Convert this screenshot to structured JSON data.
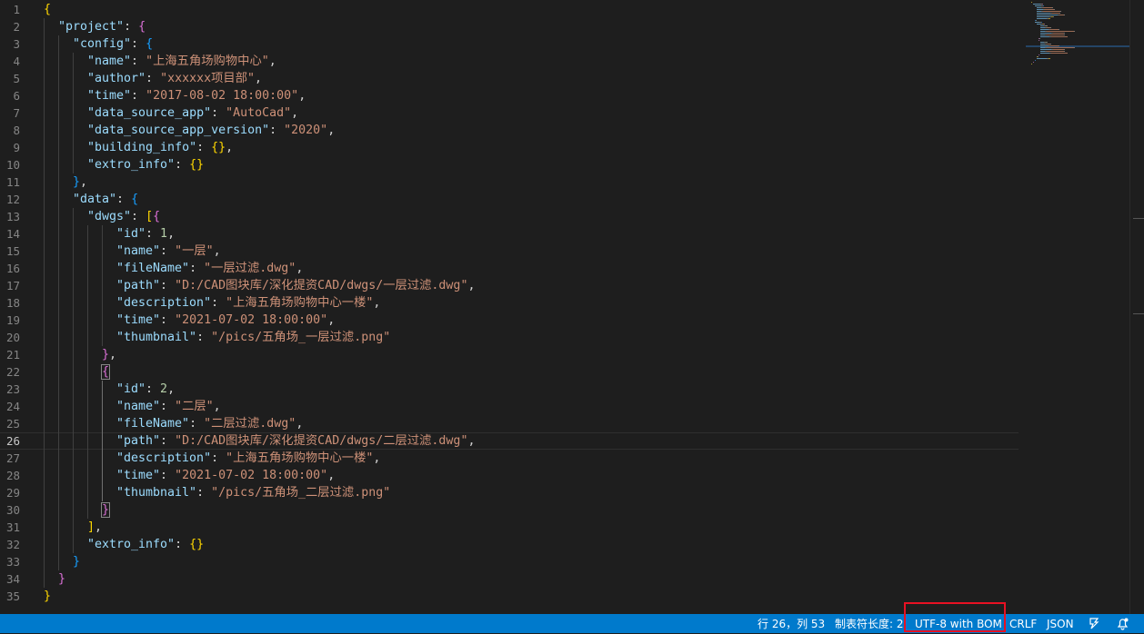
{
  "editor": {
    "current_line": 26,
    "lines": [
      [
        [
          "b1",
          "{"
        ]
      ],
      [
        [
          "k",
          "\"project\""
        ],
        [
          "p",
          ": "
        ],
        [
          "b2",
          "{"
        ]
      ],
      [
        [
          "k",
          "\"config\""
        ],
        [
          "p",
          ": "
        ],
        [
          "b3",
          "{"
        ]
      ],
      [
        [
          "k",
          "\"name\""
        ],
        [
          "p",
          ": "
        ],
        [
          "s",
          "\"上海五角场购物中心\""
        ],
        [
          "p",
          ","
        ]
      ],
      [
        [
          "k",
          "\"author\""
        ],
        [
          "p",
          ": "
        ],
        [
          "s",
          "\"xxxxxx项目部\""
        ],
        [
          "p",
          ","
        ]
      ],
      [
        [
          "k",
          "\"time\""
        ],
        [
          "p",
          ": "
        ],
        [
          "s",
          "\"2017-08-02 18:00:00\""
        ],
        [
          "p",
          ","
        ]
      ],
      [
        [
          "k",
          "\"data_source_app\""
        ],
        [
          "p",
          ": "
        ],
        [
          "s",
          "\"AutoCad\""
        ],
        [
          "p",
          ","
        ]
      ],
      [
        [
          "k",
          "\"data_source_app_version\""
        ],
        [
          "p",
          ": "
        ],
        [
          "s",
          "\"2020\""
        ],
        [
          "p",
          ","
        ]
      ],
      [
        [
          "k",
          "\"building_info\""
        ],
        [
          "p",
          ": "
        ],
        [
          "b1",
          "{}"
        ],
        [
          "p",
          ","
        ]
      ],
      [
        [
          "k",
          "\"extro_info\""
        ],
        [
          "p",
          ": "
        ],
        [
          "b1",
          "{}"
        ]
      ],
      [
        [
          "b3",
          "}"
        ],
        [
          "p",
          ","
        ]
      ],
      [
        [
          "k",
          "\"data\""
        ],
        [
          "p",
          ": "
        ],
        [
          "b3",
          "{"
        ]
      ],
      [
        [
          "k",
          "\"dwgs\""
        ],
        [
          "p",
          ": "
        ],
        [
          "b1",
          "["
        ],
        [
          "b2",
          "{"
        ]
      ],
      [
        [
          "k",
          "\"id\""
        ],
        [
          "p",
          ": "
        ],
        [
          "n",
          "1"
        ],
        [
          "p",
          ","
        ]
      ],
      [
        [
          "k",
          "\"name\""
        ],
        [
          "p",
          ": "
        ],
        [
          "s",
          "\"一层\""
        ],
        [
          "p",
          ","
        ]
      ],
      [
        [
          "k",
          "\"fileName\""
        ],
        [
          "p",
          ": "
        ],
        [
          "s",
          "\"一层过滤.dwg\""
        ],
        [
          "p",
          ","
        ]
      ],
      [
        [
          "k",
          "\"path\""
        ],
        [
          "p",
          ": "
        ],
        [
          "s",
          "\"D:/CAD图块库/深化提资CAD/dwgs/一层过滤.dwg\""
        ],
        [
          "p",
          ","
        ]
      ],
      [
        [
          "k",
          "\"description\""
        ],
        [
          "p",
          ": "
        ],
        [
          "s",
          "\"上海五角场购物中心一楼\""
        ],
        [
          "p",
          ","
        ]
      ],
      [
        [
          "k",
          "\"time\""
        ],
        [
          "p",
          ": "
        ],
        [
          "s",
          "\"2021-07-02 18:00:00\""
        ],
        [
          "p",
          ","
        ]
      ],
      [
        [
          "k",
          "\"thumbnail\""
        ],
        [
          "p",
          ": "
        ],
        [
          "s",
          "\"/pics/五角场_一层过滤.png\""
        ]
      ],
      [
        [
          "b2",
          "}"
        ],
        [
          "p",
          ","
        ]
      ],
      [
        [
          "b2m",
          "{"
        ]
      ],
      [
        [
          "k",
          "\"id\""
        ],
        [
          "p",
          ": "
        ],
        [
          "n",
          "2"
        ],
        [
          "p",
          ","
        ]
      ],
      [
        [
          "k",
          "\"name\""
        ],
        [
          "p",
          ": "
        ],
        [
          "s",
          "\"二层\""
        ],
        [
          "p",
          ","
        ]
      ],
      [
        [
          "k",
          "\"fileName\""
        ],
        [
          "p",
          ": "
        ],
        [
          "s",
          "\"二层过滤.dwg\""
        ],
        [
          "p",
          ","
        ]
      ],
      [
        [
          "k",
          "\"path\""
        ],
        [
          "p",
          ": "
        ],
        [
          "s",
          "\"D:/CAD图块库/深化提资CAD/dwgs/二层过滤.dwg\""
        ],
        [
          "p",
          ","
        ]
      ],
      [
        [
          "k",
          "\"description\""
        ],
        [
          "p",
          ": "
        ],
        [
          "s",
          "\"上海五角场购物中心一楼\""
        ],
        [
          "p",
          ","
        ]
      ],
      [
        [
          "k",
          "\"time\""
        ],
        [
          "p",
          ": "
        ],
        [
          "s",
          "\"2021-07-02 18:00:00\""
        ],
        [
          "p",
          ","
        ]
      ],
      [
        [
          "k",
          "\"thumbnail\""
        ],
        [
          "p",
          ": "
        ],
        [
          "s",
          "\"/pics/五角场_二层过滤.png\""
        ]
      ],
      [
        [
          "b2m",
          "}"
        ]
      ],
      [
        [
          "b1",
          "]"
        ],
        [
          "p",
          ","
        ]
      ],
      [
        [
          "k",
          "\"extro_info\""
        ],
        [
          "p",
          ": "
        ],
        [
          "b1",
          "{}"
        ]
      ],
      [
        [
          "b3",
          "}"
        ]
      ],
      [
        [
          "b2",
          "}"
        ]
      ],
      [
        [
          "b1",
          "}"
        ]
      ]
    ],
    "indents": [
      0,
      1,
      2,
      3,
      3,
      3,
      3,
      3,
      3,
      3,
      2,
      2,
      3,
      5,
      5,
      5,
      5,
      5,
      5,
      5,
      4,
      4,
      5,
      5,
      5,
      5,
      5,
      5,
      5,
      4,
      3,
      3,
      2,
      1,
      0
    ]
  },
  "statusbar": {
    "position": "行 26，列 53",
    "tab_size": "制表符长度: 2",
    "encoding": "UTF-8 with BOM",
    "eol": "CRLF",
    "language": "JSON",
    "icons": [
      "feedback-icon",
      "notifications-icon"
    ]
  },
  "colors": {
    "statusbar_bg": "#007acc",
    "editor_bg": "#1e1e1e",
    "highlight_box": "#e81123"
  }
}
